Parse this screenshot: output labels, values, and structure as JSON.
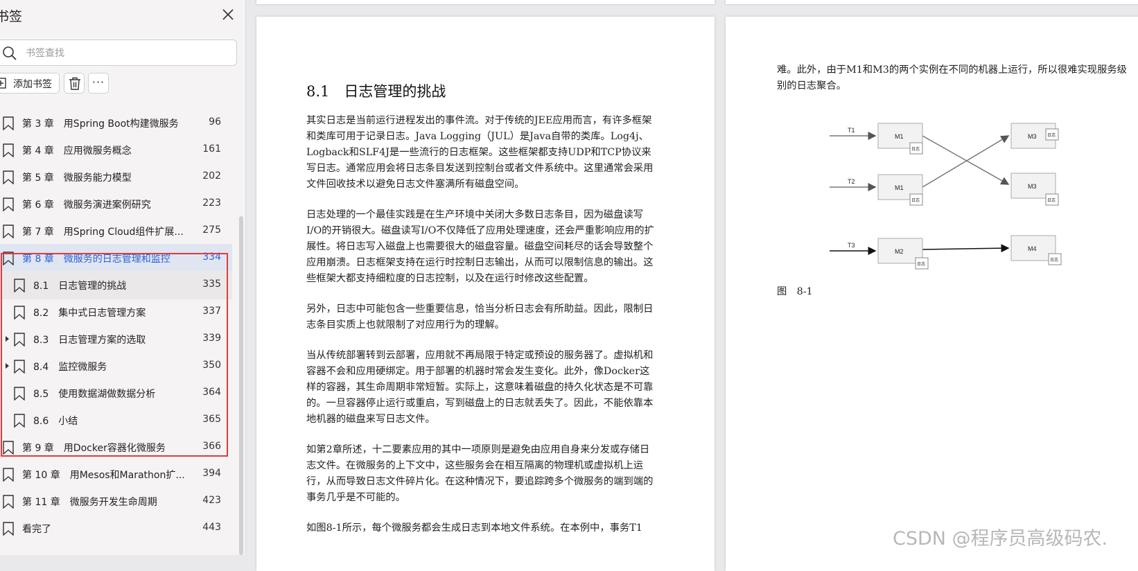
{
  "sidebar": {
    "title": "书签",
    "search_placeholder": "书签查找",
    "add_label": "添加书签",
    "more_label": "···",
    "items": [
      {
        "label": "第 3 章　用Spring Boot构建微服务",
        "page": "96"
      },
      {
        "label": "第 4 章　应用微服务概念",
        "page": "161"
      },
      {
        "label": "第 5 章　微服务能力模型",
        "page": "202"
      },
      {
        "label": "第 6 章　微服务演进案例研究",
        "page": "223"
      },
      {
        "label": "第 7 章　用Spring Cloud组件扩展...",
        "page": "275"
      },
      {
        "label": "第 8 章　微服务的日志管理和监控",
        "page": "334"
      },
      {
        "label": "8.1　日志管理的挑战",
        "page": "335"
      },
      {
        "label": "8.2　集中式日志管理方案",
        "page": "337"
      },
      {
        "label": "8.3　日志管理方案的选取",
        "page": "339"
      },
      {
        "label": "8.4　监控微服务",
        "page": "350"
      },
      {
        "label": "8.5　使用数据湖做数据分析",
        "page": "364"
      },
      {
        "label": "8.6　小结",
        "page": "365"
      },
      {
        "label": "第 9 章　用Docker容器化微服务",
        "page": "366"
      },
      {
        "label": "第 10 章　用Mesos和Marathon扩...",
        "page": "394"
      },
      {
        "label": "第 11 章　微服务开发生命周期",
        "page": "423"
      },
      {
        "label": "看完了",
        "page": "443"
      }
    ]
  },
  "document": {
    "section_heading": "8.1　日志管理的挑战",
    "left_paragraphs": [
      "其实日志是当前运行进程发出的事件流。对于传统的JEE应用而言，有许多框架和类库可用于记录日志。Java Logging（JUL）是Java自带的类库。Log4j、Logback和SLF4J是一些流行的日志框架。这些框架都支持UDP和TCP协议来写日志。通常应用会将日志条目发送到控制台或者文件系统中。这里通常会采用文件回收技术以避免日志文件塞满所有磁盘空间。",
      "日志处理的一个最佳实践是在生产环境中关闭大多数日志条目，因为磁盘读写I/O的开销很大。磁盘读写I/O不仅降低了应用处理速度，还会严重影响应用的扩展性。将日志写入磁盘上也需要很大的磁盘容量。磁盘空间耗尽的话会导致整个应用崩溃。日志框架支持在运行时控制日志输出，从而可以限制信息的输出。这些框架大都支持细粒度的日志控制，以及在运行时修改这些配置。",
      "另外，日志中可能包含一些重要信息，恰当分析日志会有所助益。因此，限制日志条目实质上也就限制了对应用行为的理解。",
      "当从传统部署转到云部署，应用就不再局限于特定或预设的服务器了。虚拟机和容器不会和应用硬绑定。用于部署的机器时常会发生变化。此外，像Docker这样的容器，其生命周期非常短暂。实际上，这意味着磁盘的持久化状态是不可靠的。一旦容器停止运行或重启，写到磁盘上的日志就丢失了。因此，不能依靠本地机器的磁盘来写日志文件。",
      "如第2章所述，十二要素应用的其中一项原则是避免由应用自身来分发或存储日志文件。在微服务的上下文中，这些服务会在相互隔离的物理机或虚拟机上运行，从而导致日志文件碎片化。在这种情况下，要追踪跨多个微服务的端到端的事务几乎是不可能的。",
      "如图8-1所示，每个微服务都会生成日志到本地文件系统。在本例中，事务T1"
    ],
    "right_intro": "难。此外，由于M1和M3的两个实例在不同的机器上运行，所以很难实现服务级别的日志聚合。",
    "figure_caption": "图　8-1",
    "diagram": {
      "nodes": [
        "M1",
        "M1",
        "M2",
        "M3",
        "M3",
        "M4"
      ],
      "transactions": [
        "T1",
        "T2",
        "T3"
      ],
      "log_label": "日志"
    }
  },
  "watermark": "CSDN @程序员高级码农."
}
